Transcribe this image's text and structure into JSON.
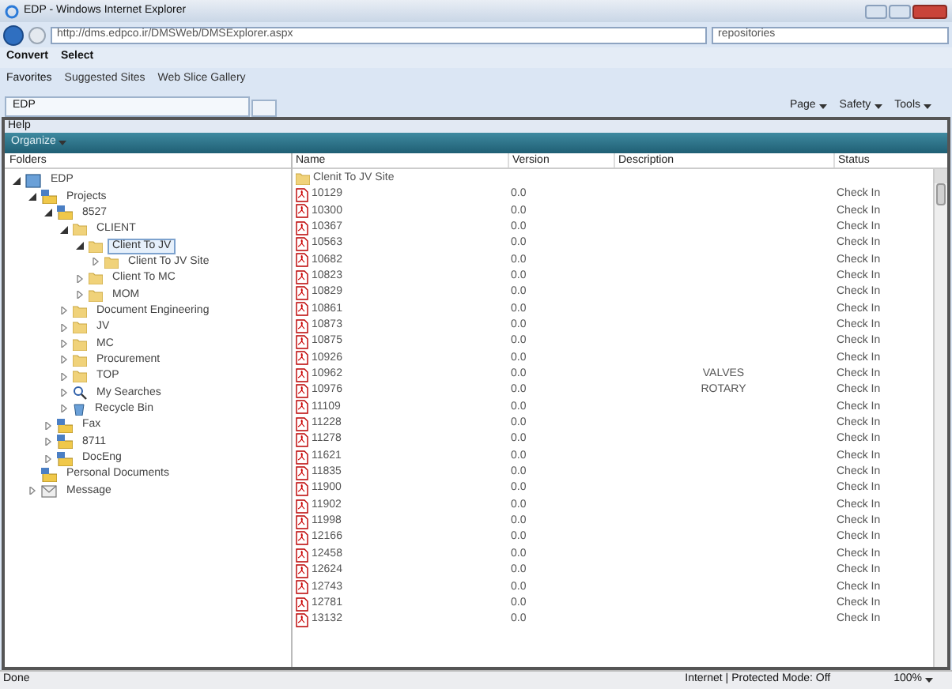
{
  "window": {
    "title": "EDP - Windows Internet Explorer"
  },
  "address": {
    "url": "http://dms.edpco.ir/DMSWeb/DMSExplorer.aspx",
    "search": "repositories"
  },
  "command_bar": [
    "Convert",
    "Select"
  ],
  "favorites_bar": {
    "favorites": "Favorites",
    "links": [
      "Suggested Sites",
      "Web Slice Gallery"
    ]
  },
  "tab": {
    "title": "EDP"
  },
  "toolbar": [
    "Page",
    "Safety",
    "Tools"
  ],
  "menu": [
    "Help"
  ],
  "organize": "Organize",
  "folders": {
    "title": "Folders",
    "tree": [
      {
        "label": "EDP",
        "kind": "root",
        "expanded": true,
        "selected": false,
        "children": [
          {
            "label": "Projects",
            "kind": "project",
            "expanded": true,
            "selected": false,
            "children": [
              {
                "label": "8527",
                "kind": "project",
                "expanded": true,
                "selected": false,
                "children": [
                  {
                    "label": "CLIENT",
                    "kind": "folder",
                    "expanded": true,
                    "selected": false,
                    "children": [
                      {
                        "label": "Client To JV",
                        "kind": "folder",
                        "expanded": true,
                        "selected": true,
                        "children": [
                          {
                            "label": "Client To JV Site",
                            "kind": "folder",
                            "expanded": false,
                            "selected": false
                          }
                        ]
                      },
                      {
                        "label": "Client To MC",
                        "kind": "folder",
                        "expanded": false,
                        "selected": false
                      },
                      {
                        "label": "MOM",
                        "kind": "folder",
                        "expanded": false,
                        "selected": false
                      }
                    ]
                  },
                  {
                    "label": "Document Engineering",
                    "kind": "folder",
                    "expanded": false,
                    "selected": false
                  },
                  {
                    "label": "JV",
                    "kind": "folder",
                    "expanded": false,
                    "selected": false
                  },
                  {
                    "label": "MC",
                    "kind": "folder",
                    "expanded": false,
                    "selected": false
                  },
                  {
                    "label": "Procurement",
                    "kind": "folder",
                    "expanded": false,
                    "selected": false
                  },
                  {
                    "label": "TOP",
                    "kind": "folder",
                    "expanded": false,
                    "selected": false
                  },
                  {
                    "label": "My Searches",
                    "kind": "search",
                    "expanded": false,
                    "selected": false
                  },
                  {
                    "label": "Recycle Bin",
                    "kind": "bin",
                    "expanded": false,
                    "selected": false
                  }
                ]
              },
              {
                "label": "Fax",
                "kind": "project",
                "expanded": false,
                "selected": false
              },
              {
                "label": "8711",
                "kind": "project",
                "expanded": false,
                "selected": false
              },
              {
                "label": "DocEng",
                "kind": "project",
                "expanded": false,
                "selected": false
              }
            ]
          },
          {
            "label": "Personal Documents",
            "kind": "project",
            "selected": false
          },
          {
            "label": "Message",
            "kind": "mail",
            "expanded": false,
            "selected": false
          }
        ]
      }
    ]
  },
  "table": {
    "columns": [
      "Name",
      "Version",
      "Description",
      "Status"
    ],
    "rows": [
      {
        "kind": "folder",
        "name": "Clenit To JV Site"
      },
      {
        "kind": "pdf",
        "name": "10129",
        "version": "0.0",
        "status": "Check In"
      },
      {
        "kind": "pdf",
        "name": "10300",
        "version": "0.0",
        "status": "Check In"
      },
      {
        "kind": "pdf",
        "name": "10367",
        "version": "0.0",
        "status": "Check In"
      },
      {
        "kind": "pdf",
        "name": "10563",
        "version": "0.0",
        "status": "Check In"
      },
      {
        "kind": "pdf",
        "name": "10682",
        "version": "0.0",
        "status": "Check In"
      },
      {
        "kind": "pdf",
        "name": "10823",
        "version": "0.0",
        "status": "Check In"
      },
      {
        "kind": "pdf",
        "name": "10829",
        "version": "0.0",
        "status": "Check In"
      },
      {
        "kind": "pdf",
        "name": "10861",
        "version": "0.0",
        "status": "Check In"
      },
      {
        "kind": "pdf",
        "name": "10873",
        "version": "0.0",
        "status": "Check In"
      },
      {
        "kind": "pdf",
        "name": "10875",
        "version": "0.0",
        "status": "Check In"
      },
      {
        "kind": "pdf",
        "name": "10926",
        "version": "0.0",
        "status": "Check In"
      },
      {
        "kind": "pdf",
        "name": "10962",
        "version": "0.0",
        "description": "VALVES",
        "status": "Check In"
      },
      {
        "kind": "pdf",
        "name": "10976",
        "version": "0.0",
        "description": "ROTARY",
        "status": "Check In"
      },
      {
        "kind": "pdf",
        "name": "11109",
        "version": "0.0",
        "status": "Check In"
      },
      {
        "kind": "pdf",
        "name": "11228",
        "version": "0.0",
        "status": "Check In"
      },
      {
        "kind": "pdf",
        "name": "11278",
        "version": "0.0",
        "status": "Check In"
      },
      {
        "kind": "pdf",
        "name": "11621",
        "version": "0.0",
        "status": "Check In"
      },
      {
        "kind": "pdf",
        "name": "11835",
        "version": "0.0",
        "status": "Check In"
      },
      {
        "kind": "pdf",
        "name": "11900",
        "version": "0.0",
        "status": "Check In"
      },
      {
        "kind": "pdf",
        "name": "11902",
        "version": "0.0",
        "status": "Check In"
      },
      {
        "kind": "pdf",
        "name": "11998",
        "version": "0.0",
        "status": "Check In"
      },
      {
        "kind": "pdf",
        "name": "12166",
        "version": "0.0",
        "status": "Check In"
      },
      {
        "kind": "pdf",
        "name": "12458",
        "version": "0.0",
        "status": "Check In"
      },
      {
        "kind": "pdf",
        "name": "12624",
        "version": "0.0",
        "status": "Check In"
      },
      {
        "kind": "pdf",
        "name": "12743",
        "version": "0.0",
        "status": "Check In"
      },
      {
        "kind": "pdf",
        "name": "12781",
        "version": "0.0",
        "status": "Check In"
      },
      {
        "kind": "pdf",
        "name": "13132",
        "version": "0.0",
        "status": "Check In"
      }
    ]
  },
  "status_bar": {
    "text": "Done",
    "zone": "Internet | Protected Mode: Off",
    "zoom": "100%"
  }
}
